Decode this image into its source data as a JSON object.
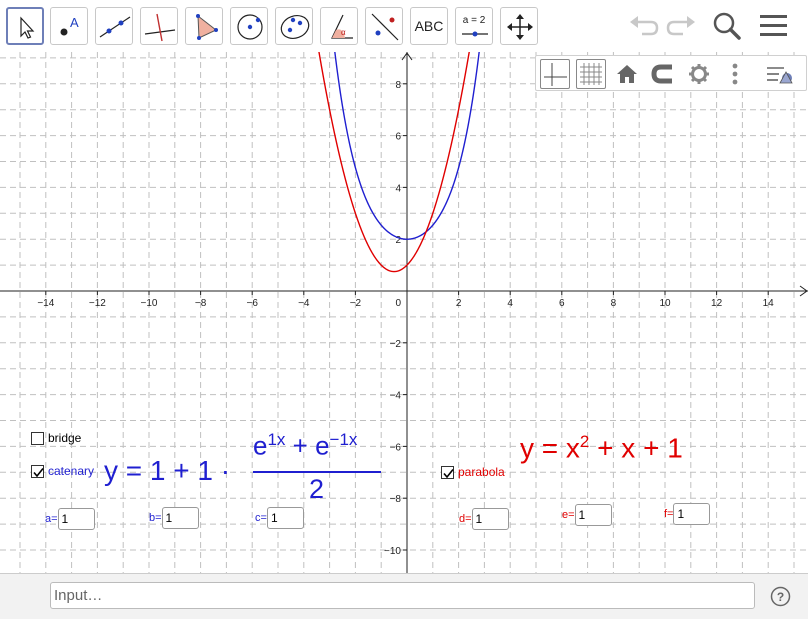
{
  "toolbar": {
    "abc_label": "ABC",
    "slider_label": "a = 2"
  },
  "input_bar": {
    "placeholder": "Input…"
  },
  "colors": {
    "blue": "#1f1fd0",
    "red": "#e00000",
    "active_tool": "#6e7fb8"
  },
  "chart_data": {
    "type": "line",
    "xlim": [
      -15.5,
      15.5
    ],
    "ylim": [
      -10.8,
      9.2
    ],
    "grid": true,
    "x_ticks": [
      -14,
      -12,
      -10,
      -8,
      -6,
      -4,
      -2,
      2,
      4,
      6,
      8,
      10,
      12,
      14
    ],
    "y_ticks": [
      8,
      6,
      4,
      2,
      -2,
      -4,
      -6,
      -8,
      -10
    ],
    "origin_label": "0",
    "series": [
      {
        "name": "catenary",
        "expression": "1 + cosh(x)",
        "color": "#1f1fd0"
      },
      {
        "name": "parabola",
        "expression": "x^2 + x + 1",
        "color": "#e00000"
      }
    ]
  },
  "objects": {
    "bridge": {
      "label": "bridge",
      "checked": false
    },
    "catenary": {
      "label": "catenary",
      "checked": true,
      "lhs": "y = 1 + 1 ·",
      "num_e1": "e",
      "num_sup1": "1x",
      "num_plus": " + ",
      "num_e2": "e",
      "num_sup2": "−1x",
      "den": "2"
    },
    "parabola": {
      "label": "parabola",
      "checked": true,
      "eq_main": "y = x",
      "eq_sup": "2",
      "eq_rest": " + x + 1"
    },
    "inputs": [
      {
        "label": "a=",
        "value": "1"
      },
      {
        "label": "b=",
        "value": "1"
      },
      {
        "label": "c=",
        "value": "1"
      },
      {
        "label": "d=",
        "value": "1"
      },
      {
        "label": "e=",
        "value": "1"
      },
      {
        "label": "f=",
        "value": "1"
      }
    ]
  }
}
